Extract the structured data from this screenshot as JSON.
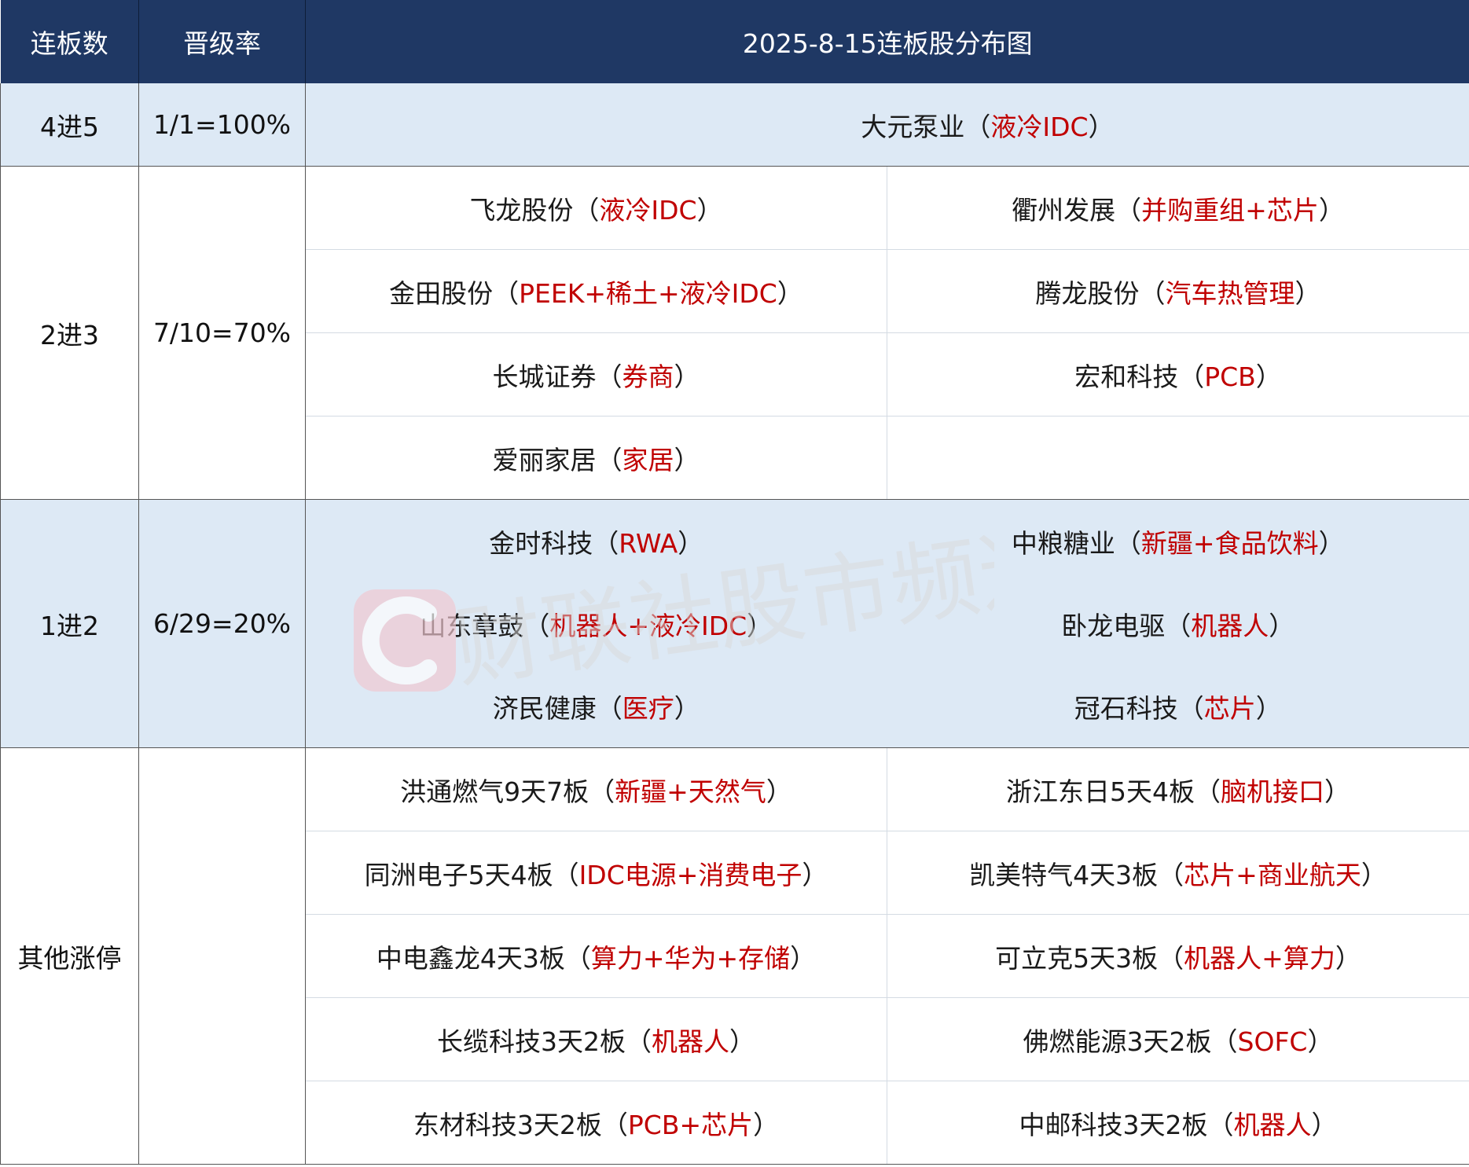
{
  "header": {
    "col1": "连板数",
    "col2": "晋级率",
    "col3": "2025-8-15连板股分布图"
  },
  "groups": [
    {
      "level": "4进5",
      "rate": "1/1=100%",
      "rows": [
        {
          "left": {
            "name": "大元泵业（",
            "tag": "液冷IDC",
            "close": "）"
          }
        }
      ]
    },
    {
      "level": "2进3",
      "rate": "7/10=70%",
      "rows": [
        {
          "left": {
            "name": "飞龙股份（",
            "tag": "液冷IDC",
            "close": "）"
          },
          "right": {
            "name": "衢州发展（",
            "tag": "并购重组+芯片",
            "close": "）"
          }
        },
        {
          "left": {
            "name": "金田股份（",
            "tag": "PEEK+稀土+液冷IDC",
            "close": "）"
          },
          "right": {
            "name": "腾龙股份（",
            "tag": "汽车热管理",
            "close": "）"
          }
        },
        {
          "left": {
            "name": "长城证券（",
            "tag": "券商",
            "close": "）"
          },
          "right": {
            "name": "宏和科技（",
            "tag": "PCB",
            "close": "）"
          }
        },
        {
          "left": {
            "name": "爱丽家居（",
            "tag": "家居",
            "close": "）"
          }
        }
      ]
    },
    {
      "level": "1进2",
      "rate": "6/29=20%",
      "rows": [
        {
          "left": {
            "name": "金时科技（",
            "tag": "RWA",
            "close": "）"
          },
          "right": {
            "name": "中粮糖业（",
            "tag": "新疆+食品饮料",
            "close": "）"
          }
        },
        {
          "left": {
            "name": "山东章鼓（",
            "tag": "机器人+液冷IDC",
            "close": "）"
          },
          "right": {
            "name": "卧龙电驱（",
            "tag": "机器人",
            "close": "）"
          }
        },
        {
          "left": {
            "name": "济民健康（",
            "tag": "医疗",
            "close": "）"
          },
          "right": {
            "name": "冠石科技（",
            "tag": "芯片",
            "close": "）"
          }
        }
      ]
    },
    {
      "level": "其他涨停",
      "rate": "",
      "rows": [
        {
          "left": {
            "name": "洪通燃气9天7板（",
            "tag": "新疆+天然气",
            "close": "）"
          },
          "right": {
            "name": "浙江东日5天4板（",
            "tag": "脑机接口",
            "close": "）"
          }
        },
        {
          "left": {
            "name": "同洲电子5天4板（",
            "tag": "IDC电源+消费电子",
            "close": "）"
          },
          "right": {
            "name": "凯美特气4天3板（",
            "tag": "芯片+商业航天",
            "close": "）"
          }
        },
        {
          "left": {
            "name": "中电鑫龙4天3板（",
            "tag": "算力+华为+存储",
            "close": "）"
          },
          "right": {
            "name": "可立克5天3板（",
            "tag": "机器人+算力",
            "close": "）"
          }
        },
        {
          "left": {
            "name": "长缆科技3天2板（",
            "tag": "机器人",
            "close": "）"
          },
          "right": {
            "name": "佛燃能源3天2板（",
            "tag": "SOFC",
            "close": "）"
          }
        },
        {
          "left": {
            "name": "东材科技3天2板（",
            "tag": "PCB+芯片",
            "close": "）"
          },
          "right": {
            "name": "中邮科技3天2板（",
            "tag": "机器人",
            "close": "）"
          }
        }
      ]
    }
  ],
  "watermark": {
    "text": "财联社股市频道",
    "icon": "cls-logo-icon",
    "color": "#f2c9d0"
  },
  "colors": {
    "header_bg": "#1f3864",
    "highlight_bg": "#dde9f5",
    "tag": "#c00000"
  }
}
